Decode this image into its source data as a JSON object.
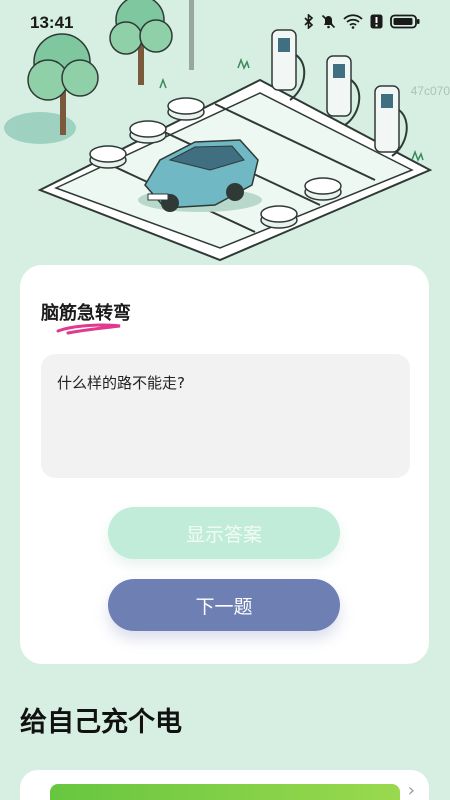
{
  "status_bar": {
    "time": "13:41",
    "icons": [
      "bluetooth-icon",
      "mute-bell-icon",
      "wifi-icon",
      "alert-icon",
      "battery-icon"
    ]
  },
  "hero": {
    "illustration": "ev-charging-parking-illustration",
    "watermark": "47c070"
  },
  "riddle_card": {
    "title": "脑筋急转弯",
    "question": "什么样的路不能走?",
    "show_answer_label": "显示答案",
    "next_label": "下一题"
  },
  "section": {
    "title": "给自己充个电"
  },
  "colors": {
    "background": "#d7efe3",
    "accent_purple": "#6e7fb3",
    "accent_mint": "#c1ecd9",
    "underline_pink": "#e0398f",
    "green_bar": "#67c63f"
  }
}
